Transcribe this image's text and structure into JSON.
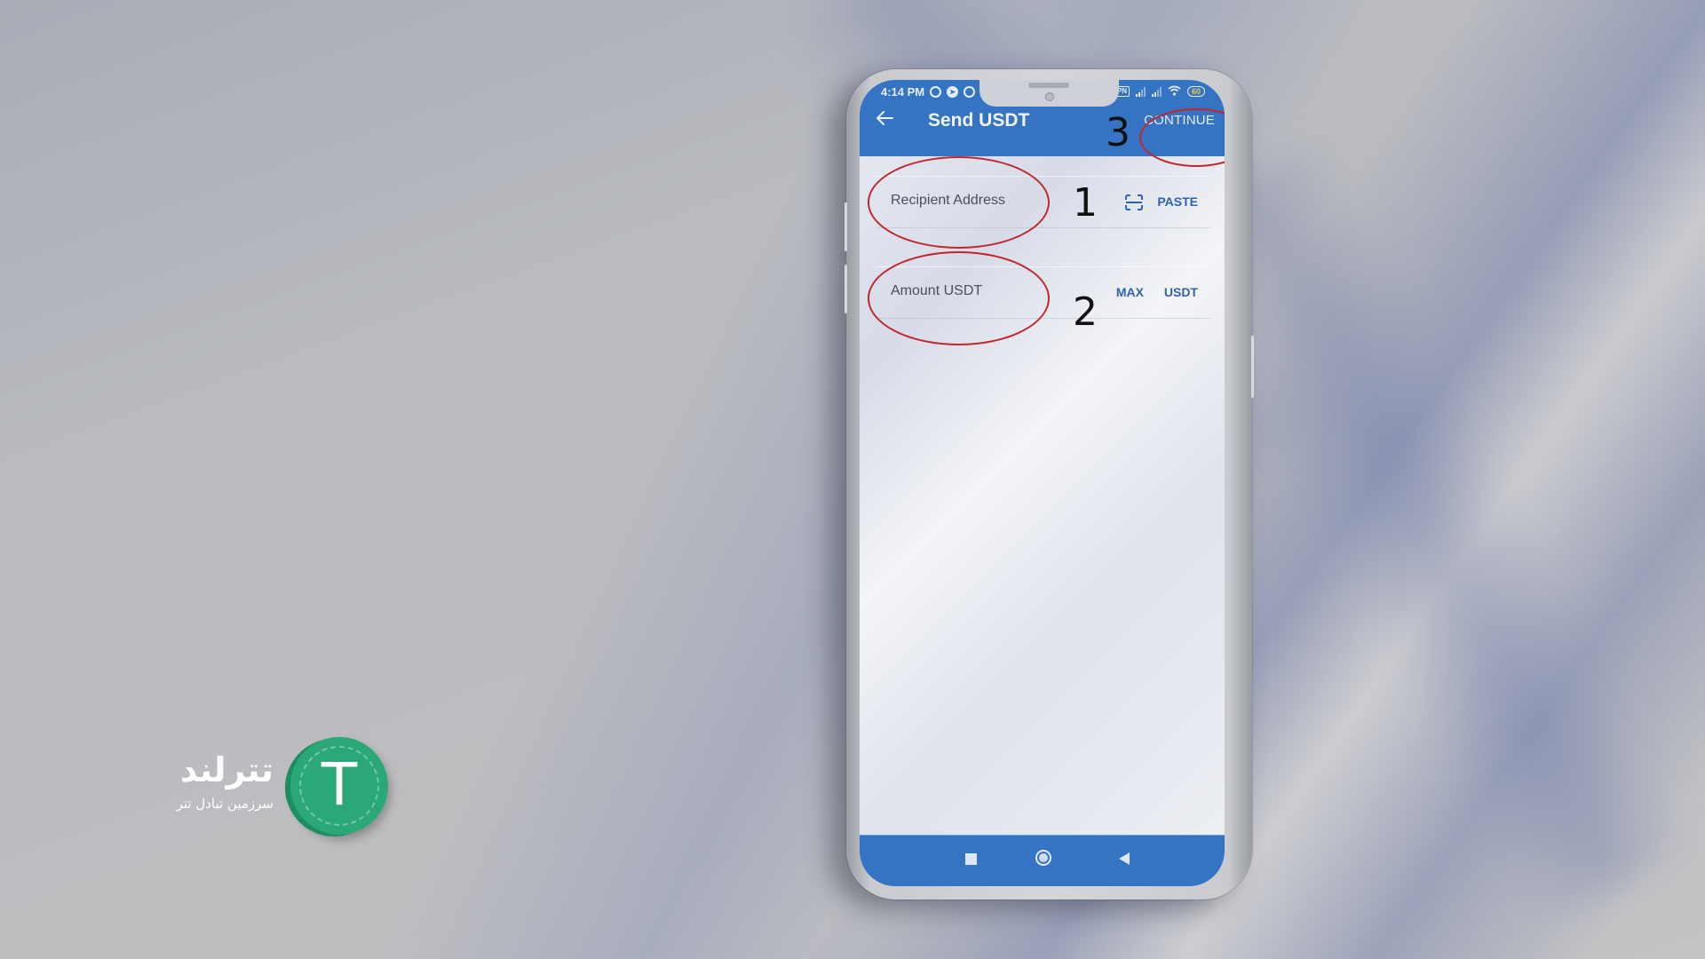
{
  "status_bar": {
    "time": "4:14 PM",
    "left_icons": [
      "alarm-icon",
      "telegram-icon",
      "messenger-icon"
    ],
    "right_icons": [
      "vpn-icon",
      "signal-icon",
      "signal-icon",
      "wifi-icon",
      "battery-icon"
    ],
    "vpn_label": "VPN",
    "battery_level": "60"
  },
  "app_bar": {
    "back_icon": "arrow-left-icon",
    "title": "Send USDT",
    "continue_label": "CONTINUE"
  },
  "form": {
    "recipient": {
      "placeholder": "Recipient Address",
      "scan_icon": "scan-qr-icon",
      "paste_label": "PASTE"
    },
    "amount": {
      "placeholder": "Amount USDT",
      "max_label": "MAX",
      "currency_label": "USDT"
    }
  },
  "annotations": {
    "step1": "1",
    "step2": "2",
    "step3": "3",
    "highlight_color": "#c0272d"
  },
  "nav_bar": {
    "items": [
      "recents-square-icon",
      "home-circle-icon",
      "back-triangle-icon"
    ]
  },
  "brand": {
    "coin_letter": "T",
    "name": "تترلند",
    "tagline": "سرزمین تبادل تتر",
    "coin_color": "#2aa877"
  },
  "colors": {
    "app_primary": "#3474c2",
    "action_text": "#2f63ad"
  }
}
